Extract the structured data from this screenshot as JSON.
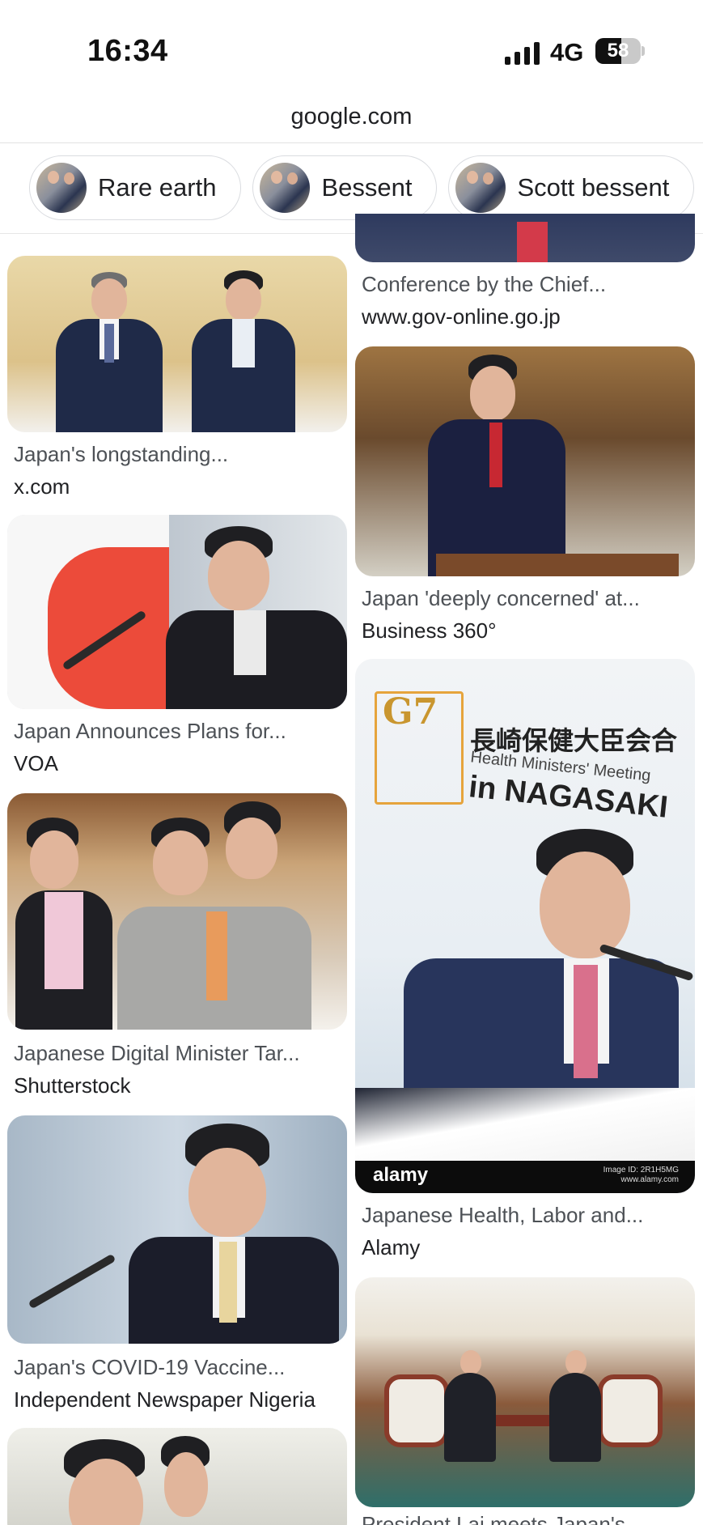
{
  "status_bar": {
    "time": "16:34",
    "network": "4G",
    "battery": "58",
    "battery_level": 0.58
  },
  "browser": {
    "url": "google.com"
  },
  "chips": [
    {
      "label": "Rare earth",
      "icon": "thumbnail-image"
    },
    {
      "label": "Bessent",
      "icon": "thumbnail-image"
    },
    {
      "label": "Scott bessent",
      "icon": "thumbnail-image"
    }
  ],
  "results": {
    "left": [
      {
        "title": "Japan's longstanding...",
        "source": "x.com"
      },
      {
        "title": "Japan Announces Plans for...",
        "source": "VOA"
      },
      {
        "title": "Japanese Digital Minister Tar...",
        "source": "Shutterstock"
      },
      {
        "title": "Japan's COVID-19 Vaccine...",
        "source": "Independent Newspaper Nigeria"
      }
    ],
    "right": [
      {
        "title": "Conference by the Chief...",
        "source": "www.gov-online.go.jp"
      },
      {
        "title": "Japan 'deeply concerned' at...",
        "source": "Business 360°"
      },
      {
        "title": "Japanese Health, Labor and...",
        "source": "Alamy",
        "image_text": {
          "logo": "G7",
          "japanese": "長崎保健大臣会合",
          "english_sub": "Health Ministers' Meeting",
          "english_main": "in NAGASAKI",
          "watermark": "alamy",
          "image_id": "Image ID: 2R1H5MG",
          "site": "www.alamy.com"
        }
      },
      {
        "title": "President Lai meets Japan's...",
        "source": ""
      }
    ]
  }
}
